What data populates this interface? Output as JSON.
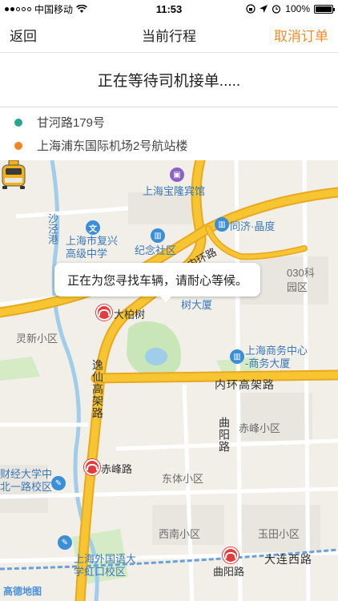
{
  "status_bar": {
    "carrier": "中国移动",
    "time": "11:53",
    "battery": "100%"
  },
  "nav": {
    "back_label": "返回",
    "title": "当前行程",
    "cancel_label": "取消订单"
  },
  "waiting_text": "正在等待司机接单.....",
  "route": {
    "start": "甘河路179号",
    "end": "上海浦东国际机场2号航站楼",
    "start_color": "#2aa592",
    "end_color": "#f5841f"
  },
  "map": {
    "tooltip": "正在为您寻找车辆，请耐心等候。",
    "labels": {
      "hotel": "上海宝隆宾馆",
      "tongji": "同济·晶度",
      "shajinggang": "沙泾港",
      "fuxing_school": "上海市复兴\n高级中学",
      "jinian": "纪念社区",
      "neihuan_top": "内环路",
      "science": "030科",
      "science_area": "园区",
      "dabaishu_station": "大柏树",
      "building": "树大厦",
      "lingxin": "灵新小区",
      "business_center": "上海商务中心\n-商务大厦",
      "yixian": "逸仙高架路",
      "neihuan": "内环高架路",
      "quyang_road": "曲阳路",
      "chifeng_area": "赤峰小区",
      "caijing": "财经大学中\n北一路校区",
      "chifeng_station": "赤峰路",
      "dongti": "东体小区",
      "xinan": "西南小区",
      "yutian": "玉田小区",
      "waiyu": "上海外国语大\n学虹口校区",
      "dalian": "大连西路",
      "quyang_station": "曲阳路",
      "logo": "高德地图"
    }
  },
  "colors": {
    "accent": "#f28c28",
    "highway": "#f7c531",
    "highway_edge": "#e8a820",
    "map_bg": "#f2efe9",
    "park": "#c8e6b8",
    "water": "#9fcdea",
    "metro": "#e23c3c"
  }
}
